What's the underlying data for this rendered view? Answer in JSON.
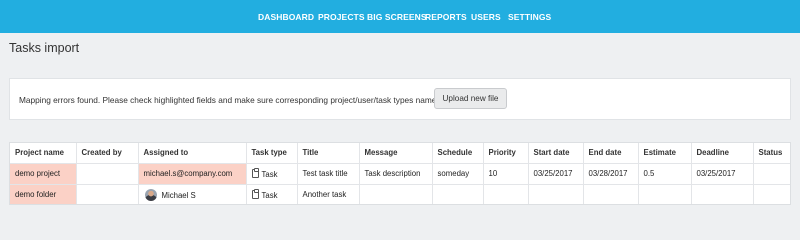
{
  "nav": {
    "items": [
      "DASHBOARD",
      "PROJECTS",
      "BIG SCREENS",
      "REPORTS",
      "USERS",
      "SETTINGS"
    ]
  },
  "page": {
    "title": "Tasks import"
  },
  "notice": {
    "message": "Mapping errors found. Please check highlighted fields and make sure corresponding project/user/task types names match.",
    "upload_button": "Upload new file"
  },
  "table": {
    "headers": [
      "Project name",
      "Created by",
      "Assigned to",
      "Task type",
      "Title",
      "Message",
      "Schedule",
      "Priority",
      "Start date",
      "End date",
      "Estimate",
      "Deadline",
      "Status"
    ],
    "rows": [
      {
        "project_name": "demo project",
        "created_by": "",
        "assigned_to": "michael.s@company.com",
        "task_type": "Task",
        "task_type_icon": "clipboard-icon",
        "title": "Test task title",
        "message": "Task description",
        "schedule": "someday",
        "priority": "10",
        "start_date": "03/25/2017",
        "end_date": "03/28/2017",
        "estimate": "0.5",
        "deadline": "03/25/2017",
        "status": "",
        "error_fields": [
          "project_name",
          "assigned_to"
        ]
      },
      {
        "project_name": "demo folder",
        "created_by": "",
        "assigned_to": "Michael S",
        "assigned_avatar": "user-avatar",
        "task_type": "Task",
        "task_type_icon": "clipboard-icon",
        "title": "Another task",
        "message": "",
        "schedule": "",
        "priority": "",
        "start_date": "",
        "end_date": "",
        "estimate": "",
        "deadline": "",
        "status": "",
        "error_fields": [
          "project_name"
        ]
      }
    ]
  },
  "colors": {
    "nav_background": "#22aee0",
    "error_highlight": "#fbd1c6",
    "page_background": "#eef0f2"
  }
}
